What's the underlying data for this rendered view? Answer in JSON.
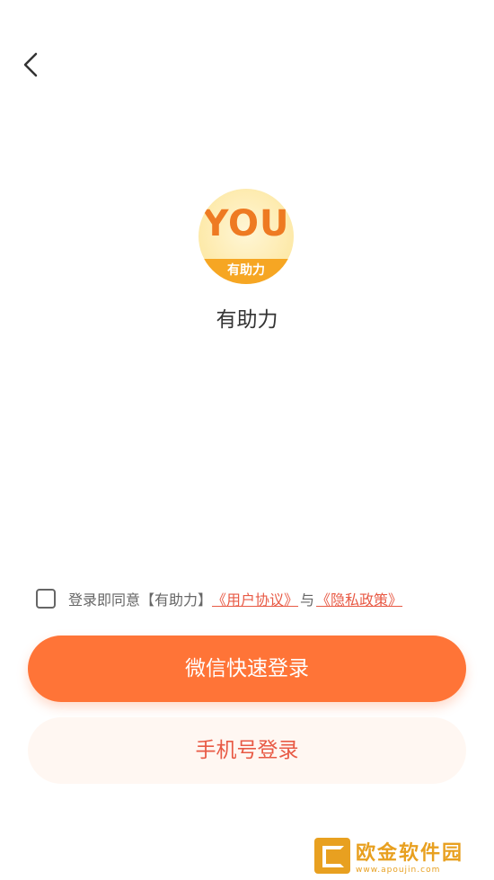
{
  "nav": {
    "back_icon": "chevron-left-icon"
  },
  "logo": {
    "word": "YOU",
    "band": "有助力"
  },
  "app": {
    "name": "有助力"
  },
  "agreement": {
    "prefix": "登录即同意【有助力】",
    "user_agreement": "《用户协议》",
    "conjunction": "与",
    "privacy_policy": "《隐私政策》",
    "checked": false
  },
  "buttons": {
    "wechat_login": "微信快速登录",
    "phone_login": "手机号登录"
  },
  "watermark": {
    "title": "欧金软件园",
    "url": "www.apoujin.com"
  },
  "colors": {
    "primary": "#ff7437",
    "secondary_bg": "#fff7f2",
    "link": "#e85a45",
    "logo_accent": "#f6a623"
  }
}
